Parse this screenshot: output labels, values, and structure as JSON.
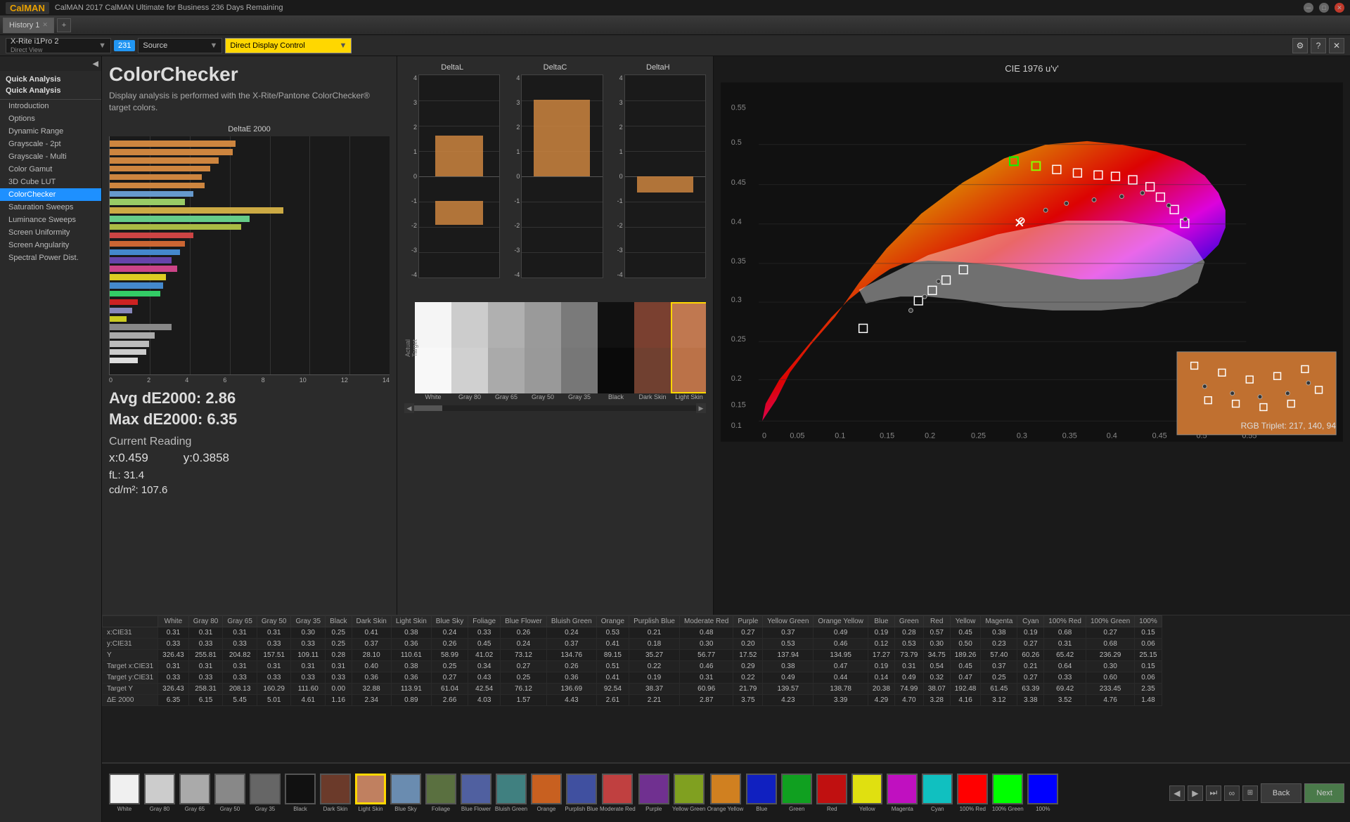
{
  "titleBar": {
    "appName": "CalMAN",
    "title": "CalMAN 2017 CalMAN Ultimate for Business 236 Days Remaining"
  },
  "toolbar": {
    "tabs": [
      {
        "label": "History 1",
        "active": true
      }
    ],
    "addTabLabel": "+"
  },
  "topControls": {
    "deviceLabel": "X-Rite i1Pro 2",
    "deviceSubLabel": "Direct View",
    "badgeText": "231",
    "sourceLabel": "Source",
    "displayLabel": "Direct Display Control",
    "settingsIcon": "⚙",
    "helpIcon": "?",
    "closeIcon": "✕"
  },
  "sidebar": {
    "sectionTitle": "Quick Analysis",
    "groupLabel": "Quick Analysis",
    "items": [
      {
        "label": "Introduction",
        "active": false
      },
      {
        "label": "Options",
        "active": false
      },
      {
        "label": "Dynamic Range",
        "active": false
      },
      {
        "label": "Grayscale - 2pt",
        "active": false
      },
      {
        "label": "Grayscale - Multi",
        "active": false
      },
      {
        "label": "Color Gamut",
        "active": false
      },
      {
        "label": "3D Cube LUT",
        "active": false
      },
      {
        "label": "ColorChecker",
        "active": true
      },
      {
        "label": "Saturation Sweeps",
        "active": false
      },
      {
        "label": "Luminance Sweeps",
        "active": false
      },
      {
        "label": "Screen Uniformity",
        "active": false
      },
      {
        "label": "Screen Angularity",
        "active": false
      },
      {
        "label": "Spectral Power Dist.",
        "active": false
      }
    ]
  },
  "colorchecker": {
    "title": "ColorChecker",
    "description": "Display analysis is performed with the X-Rite/Pantone ColorChecker® target colors."
  },
  "deltaEChart": {
    "title": "DeltaE 2000",
    "avgLabel": "Avg dE2000:",
    "avgValue": "2.86",
    "maxLabel": "Max dE2000:",
    "maxValue": "6.35"
  },
  "currentReading": {
    "title": "Current Reading",
    "xLabel": "x:",
    "xValue": "0.459",
    "yLabel": "y:",
    "yValue": "0.3858",
    "flLabel": "fL:",
    "flValue": "31.4",
    "cdLabel": "cd/m²:",
    "cdValue": "107.6"
  },
  "deltaCharts": {
    "deltaL": {
      "title": "DeltaL"
    },
    "deltaC": {
      "title": "DeltaC"
    },
    "deltaH": {
      "title": "DeltaH"
    }
  },
  "cieChart": {
    "title": "CIE 1976 u'v'",
    "rgbTriplet": "RGB Triplet: 217, 140, 94"
  },
  "dataTable": {
    "rows": [
      {
        "label": "x:CIE31",
        "values": [
          "0.31",
          "0.31",
          "0.31",
          "0.31",
          "0.30",
          "0.25",
          "0.41",
          "0.38",
          "0.24",
          "0.33",
          "0.26",
          "0.24",
          "0.53",
          "0.21",
          "0.48",
          "0.27",
          "0.37",
          "0.49",
          "0.19",
          "0.28",
          "0.57",
          "0.45",
          "0.38",
          "0.19",
          "0.68",
          "0.27",
          "0.15"
        ]
      },
      {
        "label": "y:CIE31",
        "values": [
          "0.33",
          "0.33",
          "0.33",
          "0.33",
          "0.33",
          "0.25",
          "0.37",
          "0.36",
          "0.26",
          "0.45",
          "0.24",
          "0.37",
          "0.41",
          "0.18",
          "0.30",
          "0.20",
          "0.53",
          "0.46",
          "0.12",
          "0.53",
          "0.30",
          "0.50",
          "0.23",
          "0.27",
          "0.31",
          "0.68",
          "0.06"
        ]
      },
      {
        "label": "Y",
        "values": [
          "326.43",
          "255.81",
          "204.82",
          "157.51",
          "109.11",
          "0.28",
          "28.10",
          "110.61",
          "58.99",
          "41.02",
          "73.12",
          "134.76",
          "89.15",
          "35.27",
          "56.77",
          "17.52",
          "137.94",
          "134.95",
          "17.27",
          "73.79",
          "34.75",
          "189.26",
          "57.40",
          "60.26",
          "65.42",
          "236.29",
          "25.15"
        ]
      },
      {
        "label": "Target x:CIE31",
        "values": [
          "0.31",
          "0.31",
          "0.31",
          "0.31",
          "0.31",
          "0.31",
          "0.40",
          "0.38",
          "0.25",
          "0.34",
          "0.27",
          "0.26",
          "0.51",
          "0.22",
          "0.46",
          "0.29",
          "0.38",
          "0.47",
          "0.19",
          "0.31",
          "0.54",
          "0.45",
          "0.37",
          "0.21",
          "0.64",
          "0.30",
          "0.15"
        ]
      },
      {
        "label": "Target y:CIE31",
        "values": [
          "0.33",
          "0.33",
          "0.33",
          "0.33",
          "0.33",
          "0.33",
          "0.36",
          "0.36",
          "0.27",
          "0.43",
          "0.25",
          "0.36",
          "0.41",
          "0.19",
          "0.31",
          "0.22",
          "0.49",
          "0.44",
          "0.14",
          "0.49",
          "0.32",
          "0.47",
          "0.25",
          "0.27",
          "0.33",
          "0.60",
          "0.06"
        ]
      },
      {
        "label": "Target Y",
        "values": [
          "326.43",
          "258.31",
          "208.13",
          "160.29",
          "111.60",
          "0.00",
          "32.88",
          "113.91",
          "61.04",
          "42.54",
          "76.12",
          "136.69",
          "92.54",
          "38.37",
          "60.96",
          "21.79",
          "139.57",
          "138.78",
          "20.38",
          "74.99",
          "38.07",
          "192.48",
          "61.45",
          "63.39",
          "69.42",
          "233.45",
          "2.35"
        ]
      },
      {
        "label": "ΔE 2000",
        "values": [
          "6.35",
          "6.15",
          "5.45",
          "5.01",
          "4.61",
          "1.16",
          "2.34",
          "0.89",
          "2.66",
          "4.03",
          "1.57",
          "4.43",
          "2.61",
          "2.21",
          "2.87",
          "3.75",
          "4.23",
          "3.39",
          "4.29",
          "4.70",
          "3.28",
          "4.16",
          "3.12",
          "3.38",
          "3.52",
          "4.76",
          "1.48"
        ]
      }
    ],
    "columns": [
      "White",
      "Gray 80",
      "Gray 65",
      "Gray 50",
      "Gray 35",
      "Black",
      "Dark Skin",
      "Light Skin",
      "Blue Sky",
      "Foliage",
      "Blue Flower",
      "Bluish Green",
      "Orange",
      "Purplish Blue",
      "Moderate Red",
      "Purple",
      "Yellow Green",
      "Orange Yellow",
      "Blue",
      "Green",
      "Red",
      "Yellow",
      "Magenta",
      "Cyan",
      "100% Red",
      "100% Green",
      "100%"
    ]
  },
  "bottomSwatches": [
    {
      "label": "White",
      "color": "#f0f0f0",
      "active": false
    },
    {
      "label": "Gray 80",
      "color": "#cccccc",
      "active": false
    },
    {
      "label": "Gray 65",
      "color": "#aaaaaa",
      "active": false
    },
    {
      "label": "Gray 50",
      "color": "#888888",
      "active": false
    },
    {
      "label": "Gray 35",
      "color": "#666666",
      "active": false
    },
    {
      "label": "Black",
      "color": "#111111",
      "active": false
    },
    {
      "label": "Dark Skin",
      "color": "#6b3a2a",
      "active": false
    },
    {
      "label": "Light Skin",
      "color": "#c08060",
      "active": true
    },
    {
      "label": "Blue Sky",
      "color": "#6a8cb0",
      "active": false
    },
    {
      "label": "Foliage",
      "color": "#5a7040",
      "active": false
    },
    {
      "label": "Blue Flower",
      "color": "#5060a0",
      "active": false
    },
    {
      "label": "Bluish Green",
      "color": "#408080",
      "active": false
    },
    {
      "label": "Orange",
      "color": "#c86020",
      "active": false
    },
    {
      "label": "Purplish Blue",
      "color": "#4050a0",
      "active": false
    },
    {
      "label": "Moderate Red",
      "color": "#c04040",
      "active": false
    },
    {
      "label": "Purple",
      "color": "#703090",
      "active": false
    },
    {
      "label": "Yellow Green",
      "color": "#80a020",
      "active": false
    },
    {
      "label": "Orange Yellow",
      "color": "#d08020",
      "active": false
    },
    {
      "label": "Blue",
      "color": "#1020c0",
      "active": false
    },
    {
      "label": "Green",
      "color": "#10a020",
      "active": false
    },
    {
      "label": "Red",
      "color": "#c01010",
      "active": false
    },
    {
      "label": "Yellow",
      "color": "#e0e010",
      "active": false
    },
    {
      "label": "Magenta",
      "color": "#c010c0",
      "active": false
    },
    {
      "label": "Cyan",
      "color": "#10c0c0",
      "active": false
    },
    {
      "label": "100% Red",
      "color": "#ff0000",
      "active": false
    },
    {
      "label": "100% Green",
      "color": "#00ff00",
      "active": false
    },
    {
      "label": "100%",
      "color": "#0000ff",
      "active": false
    }
  ],
  "navigation": {
    "backLabel": "Back",
    "nextLabel": "Next"
  }
}
